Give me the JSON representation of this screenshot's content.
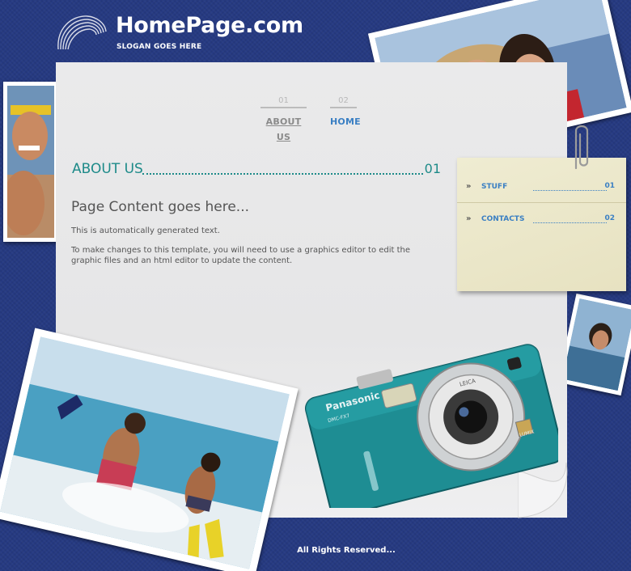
{
  "brand": {
    "title": "HomePage.com",
    "slogan": "SLOGAN GOES HERE"
  },
  "nav": {
    "items": [
      {
        "num": "01",
        "label": "ABOUT US"
      },
      {
        "num": "02",
        "label": "HOME"
      }
    ]
  },
  "section": {
    "title": "ABOUT US",
    "num": "01"
  },
  "content": {
    "heading": "Page Content goes here...",
    "p1": "This is automatically generated text.",
    "p2": "To make changes to this template, you will need to use a graphics editor to edit the graphic files and an html editor to update the content."
  },
  "sidebar": {
    "items": [
      {
        "label": "STUFF",
        "num": "01"
      },
      {
        "label": "CONTACTS",
        "num": "02"
      }
    ]
  },
  "camera": {
    "brand": "Panasonic",
    "model": "DMC-FX7",
    "lens_brand": "LEICA",
    "badge": "LUMIX"
  },
  "footer": {
    "text": "All Rights Reserved..."
  },
  "colors": {
    "background": "#263a82",
    "accent_teal": "#1d8a89",
    "link_blue": "#3a7fc3"
  }
}
